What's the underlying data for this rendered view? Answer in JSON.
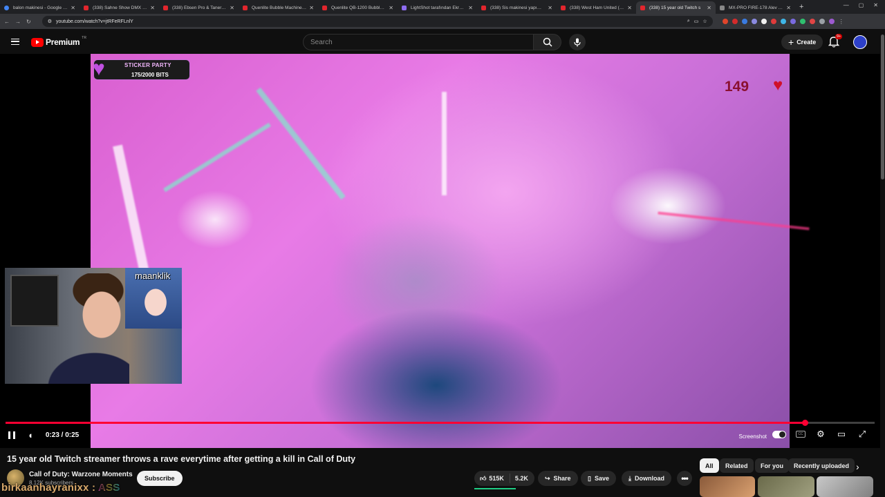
{
  "browser": {
    "tabs": [
      {
        "title": "balon makinesi - Google Sho",
        "icon": "google-icon"
      },
      {
        "title": "(338) Sahne Show DMX Konto",
        "icon": "youtube-icon"
      },
      {
        "title": "(338) Ebsen Pro & Taner Yalçı",
        "icon": "youtube-icon"
      },
      {
        "title": "Quenlite Bubble Machine-10C",
        "icon": "youtube-icon"
      },
      {
        "title": "Quenlite QB-1200 Bubble Ma",
        "icon": "youtube-icon"
      },
      {
        "title": "LightShot tarafından Ekran Gö",
        "icon": "lightshot-icon"
      },
      {
        "title": "(338) Sis makinesi yapımı , ha",
        "icon": "youtube-icon"
      },
      {
        "title": "(338) West Ham United (4-0)",
        "icon": "youtube-icon"
      },
      {
        "title": "(338) 15 year old Twitch s",
        "icon": "youtube-icon",
        "active": true
      },
      {
        "title": "MX-PRO FIRE-178 Alev Maki",
        "icon": "generic-icon"
      }
    ],
    "url": "youtube.com/watch?v=jtRFeRFLnlY"
  },
  "header": {
    "logo_text": "Premium",
    "logo_country": "TR",
    "search_placeholder": "Search",
    "create_label": "Create",
    "notif_badge": "9+"
  },
  "video": {
    "sticker_title": "STICKER PARTY",
    "sticker_bits": "175/2000 BITS",
    "counter": "149",
    "cam_label": "maanklik",
    "time_current": "0:23",
    "time_total": "0:25",
    "time_display": "0:23 / 0:25",
    "progress_fraction": 0.92,
    "screenshot_label": "Screenshot"
  },
  "info": {
    "title": "15 year old Twitch streamer throws a rave everytime after getting a kill in Call of Duty",
    "channel_name": "Call of Duty: Warzone Moments",
    "channel_subs": "8.12K subscribers",
    "subscribe_label": "Subscribe",
    "likes": "515K",
    "dislikes": "5.2K",
    "share_label": "Share",
    "save_label": "Save",
    "download_label": "Download",
    "overlay_name": "birkaanhayranixx :",
    "overlay_word": "ASS"
  },
  "chips": [
    "All",
    "Related",
    "For you",
    "Recently uploaded"
  ],
  "colors": {
    "accent": "#ff0033",
    "like_underline": "#1fcf85"
  }
}
